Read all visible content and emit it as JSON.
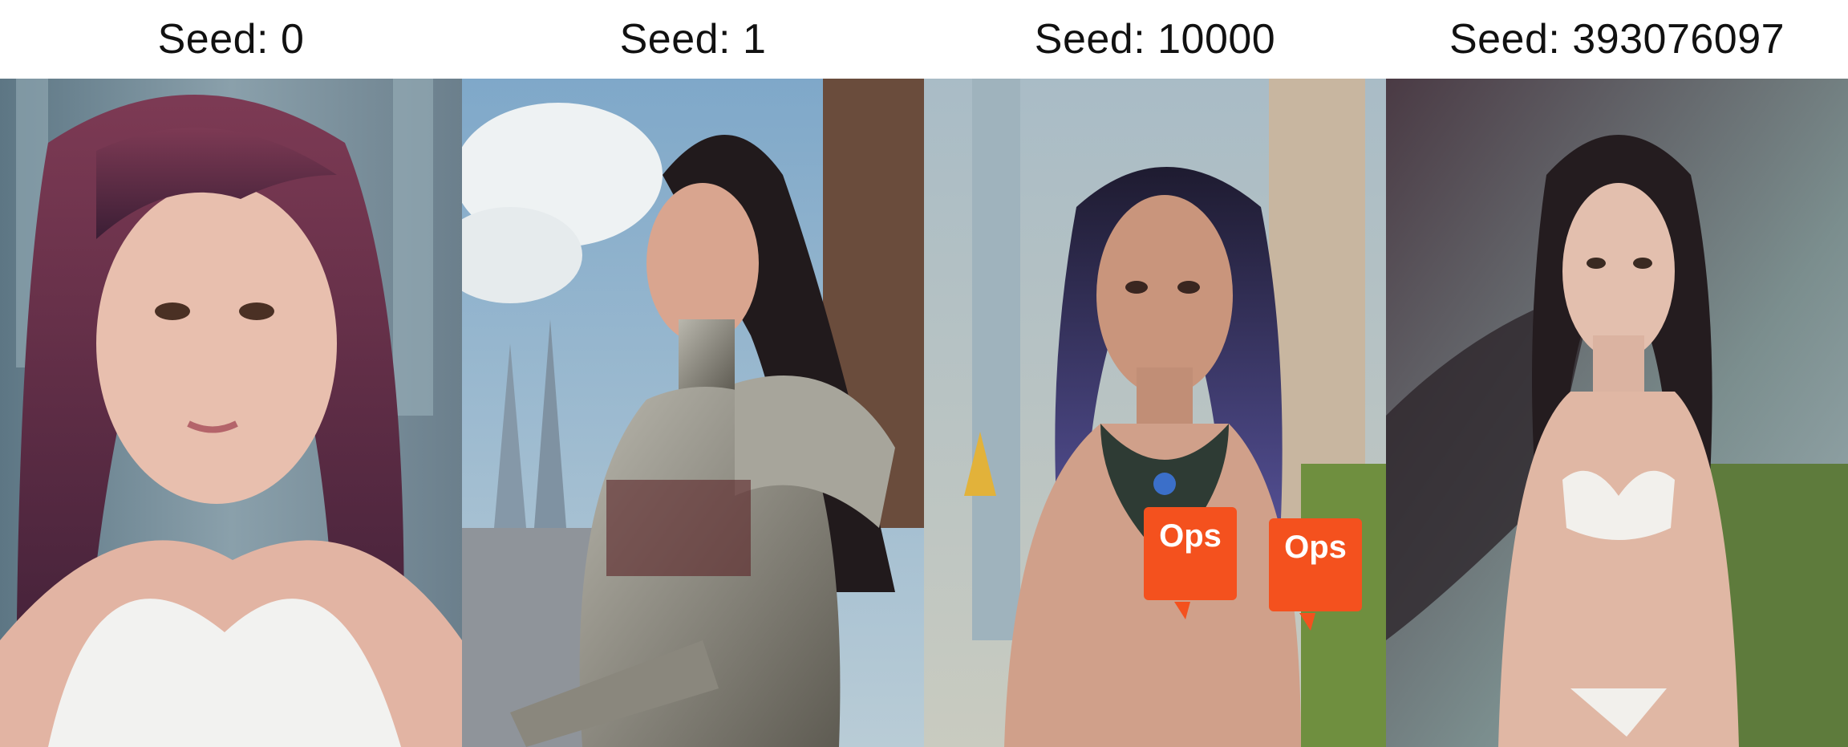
{
  "panels": [
    {
      "caption": "Seed: 0"
    },
    {
      "caption": "Seed: 1"
    },
    {
      "caption": "Seed: 10000"
    },
    {
      "caption": "Seed: 393076097"
    }
  ],
  "overlays": {
    "label_left": "Ops",
    "label_right": "Ops",
    "color": "#f4511e"
  }
}
